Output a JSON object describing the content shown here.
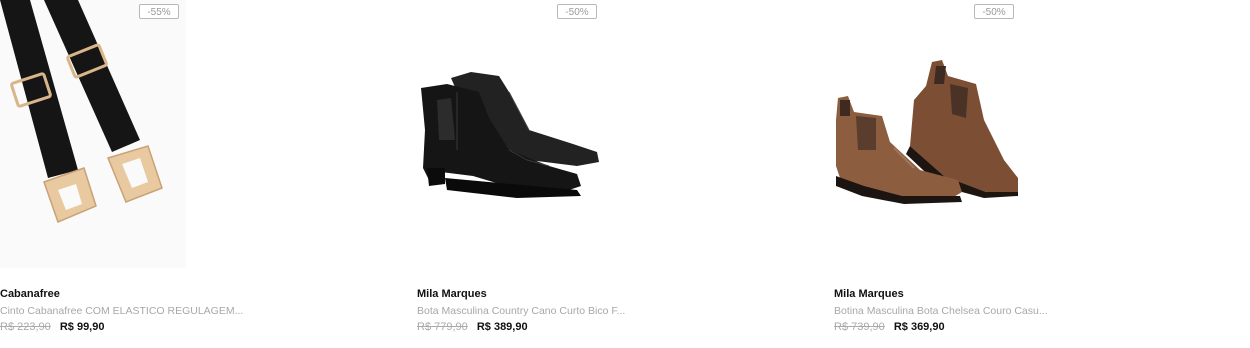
{
  "products": [
    {
      "discount": "-55%",
      "brand": "Cabanafree",
      "name": "Cinto Cabanafree COM ELASTICO REGULAGEM...",
      "old_price": "R$ 223,90",
      "price": "R$ 99,90",
      "image_icon": "belt-icon"
    },
    {
      "discount": "-50%",
      "brand": "Mila Marques",
      "name": "Bota Masculina Country Cano Curto Bico F...",
      "old_price": "R$ 779,90",
      "price": "R$ 389,90",
      "image_icon": "black-boots-icon"
    },
    {
      "discount": "-50%",
      "brand": "Mila Marques",
      "name": "Botina Masculina Bota Chelsea Couro Casu...",
      "old_price": "R$ 739,90",
      "price": "R$ 369,90",
      "image_icon": "brown-chelsea-boots-icon"
    }
  ],
  "colors": {
    "badge_border": "#b8b8b8",
    "badge_text": "#9a9a9a",
    "desc_text": "#a8a8a8",
    "old_price": "#aaaaaa",
    "price": "#111111",
    "belt_black": "#151515",
    "belt_buckle": "#e3c39a",
    "boot_black": "#1a1a1a",
    "boot_brown": "#8a5a3e"
  }
}
